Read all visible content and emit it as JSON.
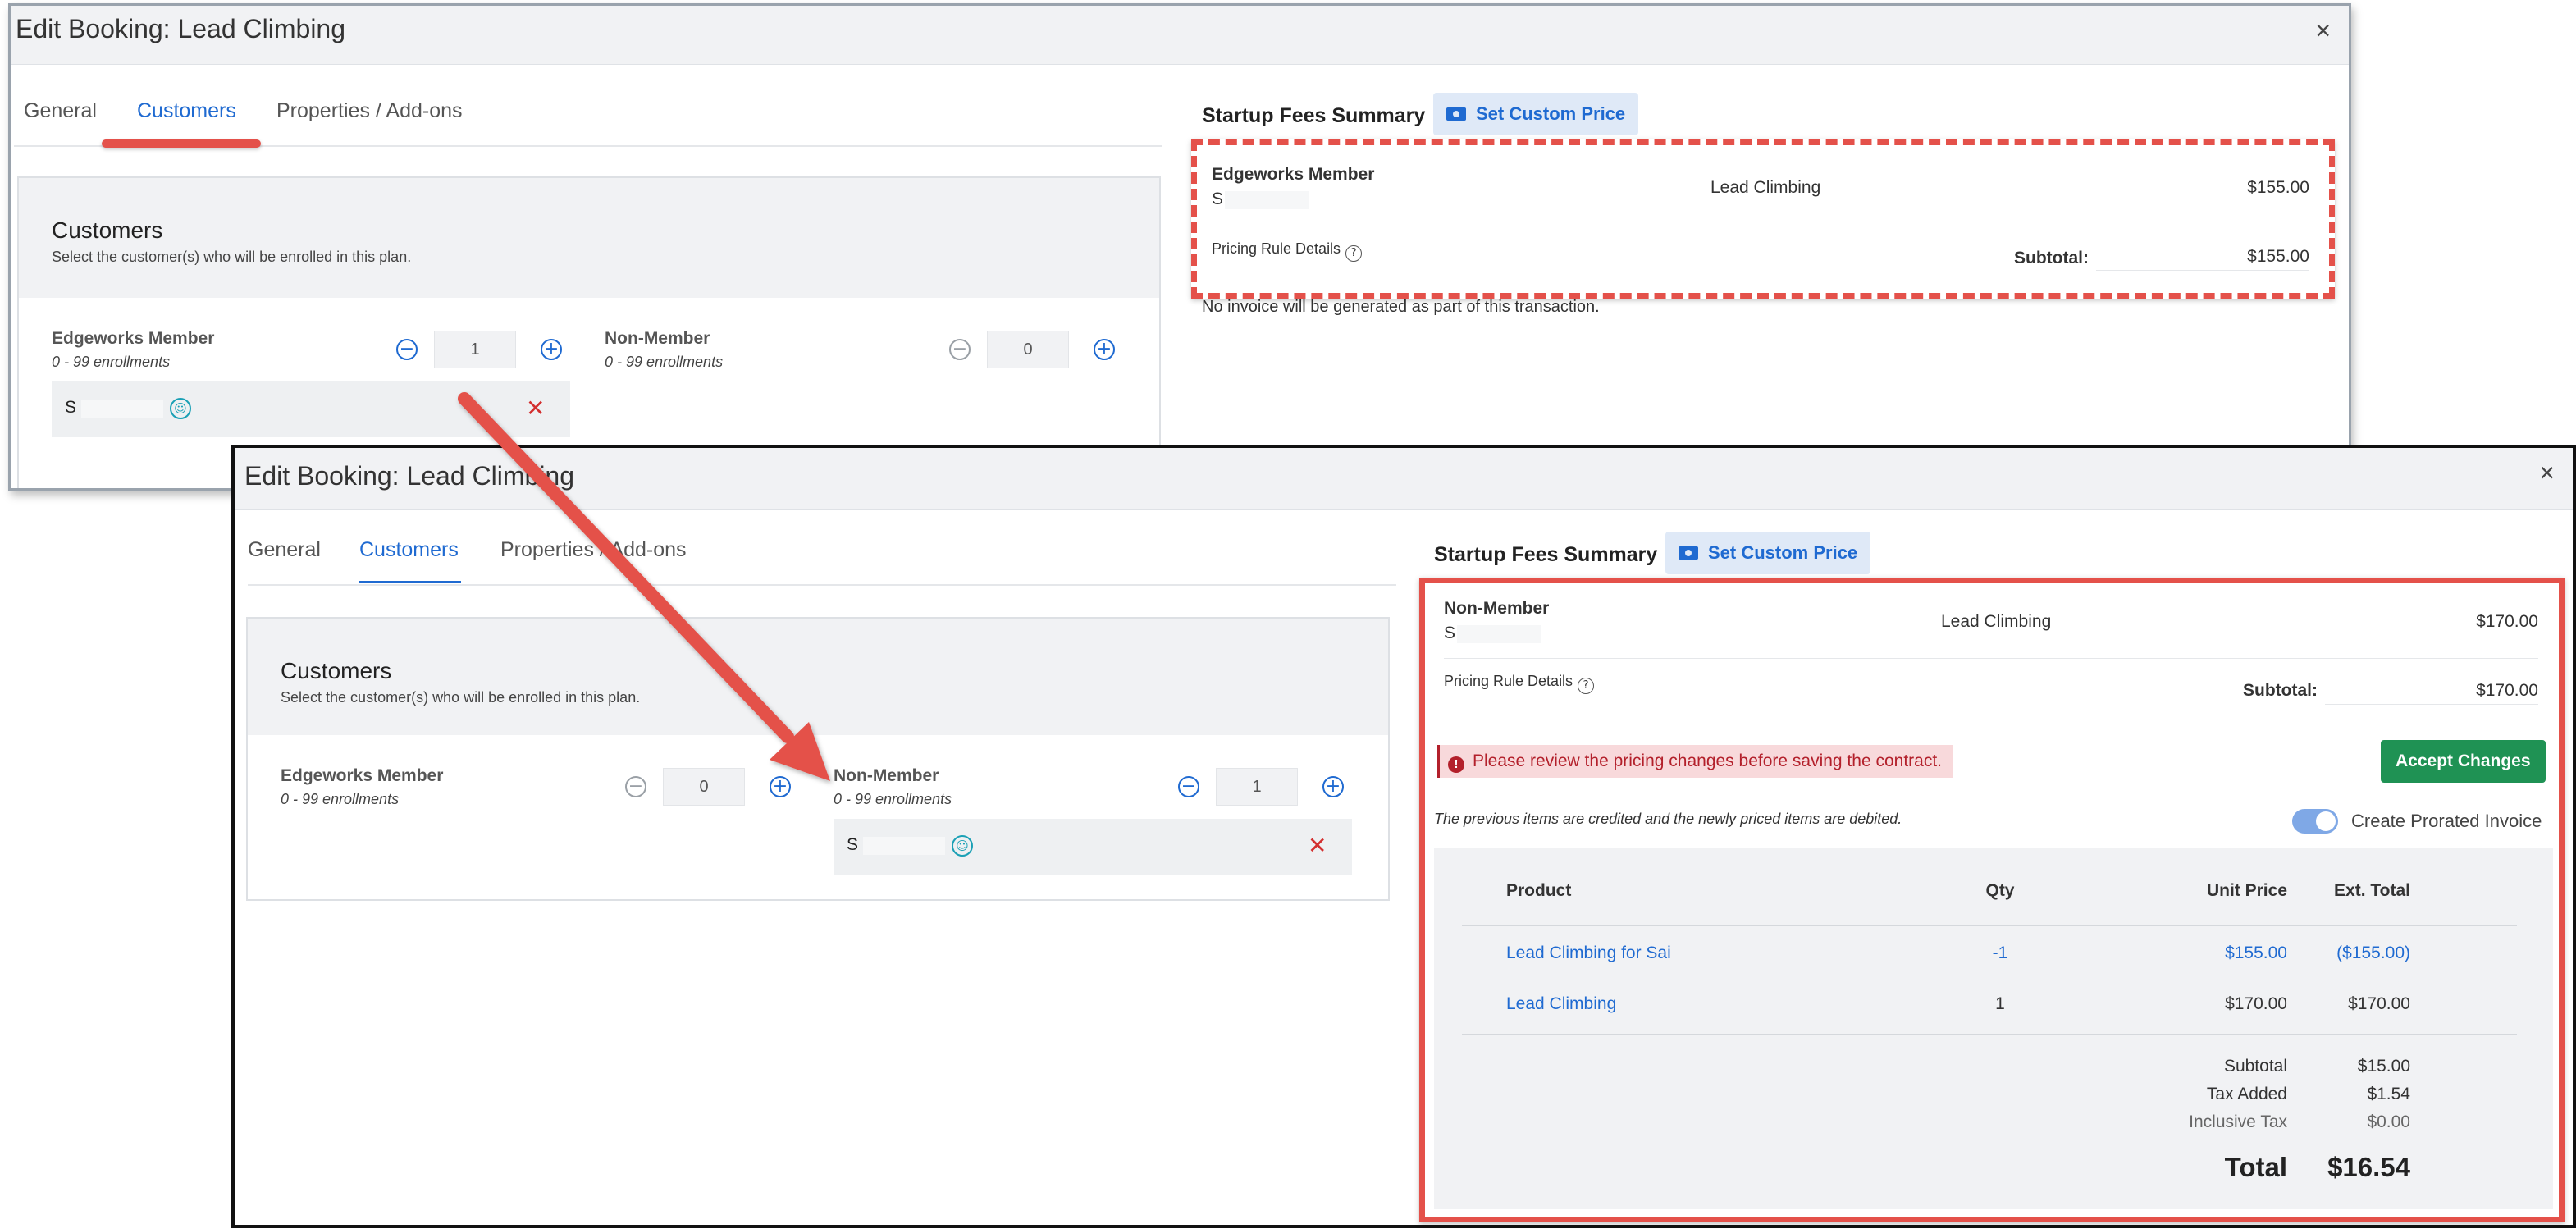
{
  "back_dialog": {
    "title": "Edit Booking: Lead Climbing",
    "close": "×",
    "tabs": [
      "General",
      "Customers",
      "Properties / Add-ons"
    ],
    "customers": {
      "heading": "Customers",
      "subheading": "Select the customer(s) who will be enrolled in this plan.",
      "groups": [
        {
          "name": "Edgeworks Member",
          "range": "0 - 99 enrollments",
          "qty": "1",
          "customer": "S"
        },
        {
          "name": "Non-Member",
          "range": "0 - 99 enrollments",
          "qty": "0"
        }
      ]
    },
    "summary": {
      "title": "Startup Fees Summary",
      "custom_price_label": "Set Custom Price",
      "member_type": "Edgeworks Member",
      "customer": "S",
      "product": "Lead Climbing",
      "price": "$155.00",
      "rule_details": "Pricing Rule Details",
      "subtotal_label": "Subtotal:",
      "subtotal": "$155.00",
      "note": "No invoice will be generated as part of this transaction."
    }
  },
  "front_dialog": {
    "title": "Edit Booking: Lead Climbing",
    "close": "×",
    "tabs": [
      "General",
      "Customers",
      "Properties / Add-ons"
    ],
    "customers": {
      "heading": "Customers",
      "subheading": "Select the customer(s) who will be enrolled in this plan.",
      "groups": [
        {
          "name": "Edgeworks Member",
          "range": "0 - 99 enrollments",
          "qty": "0"
        },
        {
          "name": "Non-Member",
          "range": "0 - 99 enrollments",
          "qty": "1",
          "customer": "S"
        }
      ]
    },
    "summary": {
      "title": "Startup Fees Summary",
      "custom_price_label": "Set Custom Price",
      "member_type": "Non-Member",
      "customer": "S",
      "product": "Lead Climbing",
      "price": "$170.00",
      "rule_details": "Pricing Rule Details",
      "subtotal_label": "Subtotal:",
      "subtotal": "$170.00",
      "alert": "Please review the pricing changes before saving the contract.",
      "accept_label": "Accept Changes",
      "credit_note": "The previous items are credited and the newly priced items are debited.",
      "toggle_label": "Create Prorated Invoice",
      "table": {
        "headers": [
          "Product",
          "Qty",
          "Unit Price",
          "Ext. Total"
        ],
        "rows": [
          {
            "product": "Lead Climbing for Sai",
            "qty": "-1",
            "unit_price": "$155.00",
            "ext_total": "($155.00)"
          },
          {
            "product": "Lead Climbing",
            "qty": "1",
            "unit_price": "$170.00",
            "ext_total": "$170.00"
          }
        ],
        "totals": [
          {
            "label": "Subtotal",
            "value": "$15.00"
          },
          {
            "label": "Tax Added",
            "value": "$1.54"
          },
          {
            "label": "Inclusive Tax",
            "value": "$0.00"
          }
        ],
        "grand_label": "Total",
        "grand_value": "$16.54"
      }
    }
  },
  "colors": {
    "accent": "#1f6ad1",
    "highlight": "#e4514a",
    "success": "#1f9254",
    "error": "#b3202b"
  },
  "icons": [
    "close-icon",
    "minus-circle-icon",
    "plus-circle-icon",
    "person-circle-icon",
    "delete-x-icon",
    "money-icon",
    "help-circle-icon",
    "alert-icon",
    "toggle-switch"
  ]
}
